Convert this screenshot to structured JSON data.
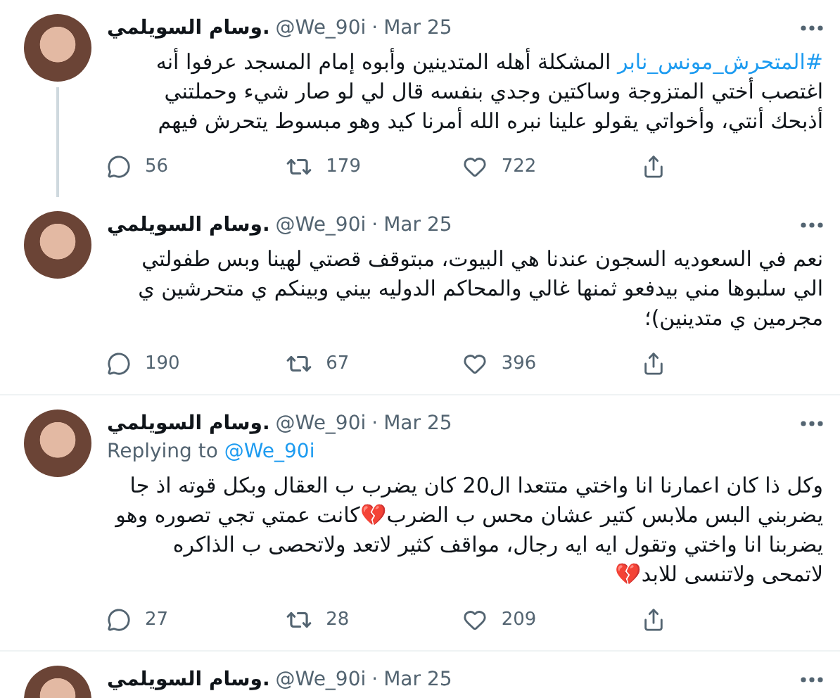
{
  "tweets": [
    {
      "name": "وسام السويلمي.",
      "handle": "@We_90i",
      "separator": "·",
      "date": "Mar 25",
      "thread_line": true,
      "hashtag": "#المتحرش_مونس_نابر",
      "text": "المشكلة أهله المتدينين وأبوه إمام المسجد عرفوا أنه اغتصب أختي المتزوجة وساكتين وجدي بنفسه قال لي لو صار شيء وحملتني أذبحك أنتي، وأخواتي يقولو علينا نبره الله أمرنا كيد وهو مبسوط يتحرش فيهم",
      "replies": "56",
      "retweets": "179",
      "likes": "722"
    },
    {
      "name": "وسام السويلمي.",
      "handle": "@We_90i",
      "separator": "·",
      "date": "Mar 25",
      "thread_line": false,
      "text": "نعم في السعوديه السجون عندنا هي البيوت، مبتوقف قصتي لهينا وبس طفولتي الي سلبوها مني بيدفعو ثمنها غالي والمحاكم الدوليه بيني وبينكم ي متحرشين ي مجرمين ي متدينين)؛",
      "replies": "190",
      "retweets": "67",
      "likes": "396"
    },
    {
      "name": "وسام السويلمي.",
      "handle": "@We_90i",
      "separator": "·",
      "date": "Mar 25",
      "thread_line": false,
      "replying_label": "Replying to",
      "replying_to": "@We_90i",
      "text": "وكل ذا كان اعمارنا انا واختي متتعدا ال20 كان يضرب ب العقال وبكل قوته اذ جا يضربني البس ملابس كتير عشان محس ب الضرب💔كانت عمتي تجي تصوره وهو يضربنا انا واختي وتقول ايه ايه رجال، مواقف كثير لاتعد ولاتحصى ب الذاكره لاتمحى ولاتنسى للابد💔",
      "replies": "27",
      "retweets": "28",
      "likes": "209"
    },
    {
      "name": "وسام السويلمي.",
      "handle": "@We_90i",
      "separator": "·",
      "date": "Mar 25",
      "thread_line": false
    }
  ]
}
